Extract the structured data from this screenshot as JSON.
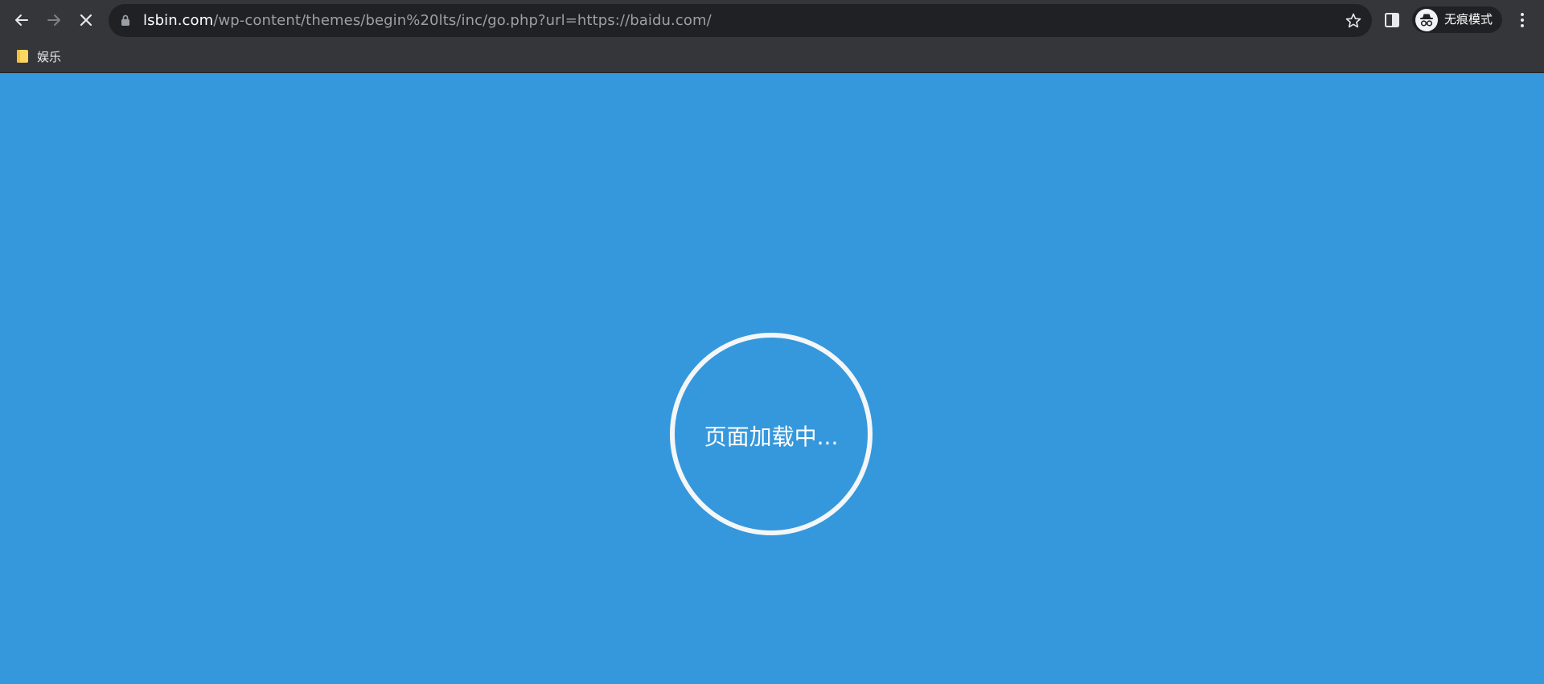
{
  "browser": {
    "back_icon": "arrow-left-icon",
    "forward_icon": "arrow-right-icon",
    "stop_icon": "close-icon",
    "address": {
      "lock_icon": "lock-icon",
      "host": "lsbin.com",
      "path": "/wp-content/themes/begin%20lts/inc/go.php?url=https://baidu.com/",
      "bookmark_icon": "star-icon"
    },
    "side_panel_icon": "side-panel-icon",
    "incognito": {
      "icon": "incognito-icon",
      "label": "无痕模式"
    },
    "menu_icon": "more-vert-icon"
  },
  "bookmarks_bar": {
    "items": [
      {
        "icon": "folder-icon",
        "label": "娱乐"
      }
    ]
  },
  "page": {
    "background_color": "#3598dc",
    "loading_text": "页面加载中..."
  }
}
